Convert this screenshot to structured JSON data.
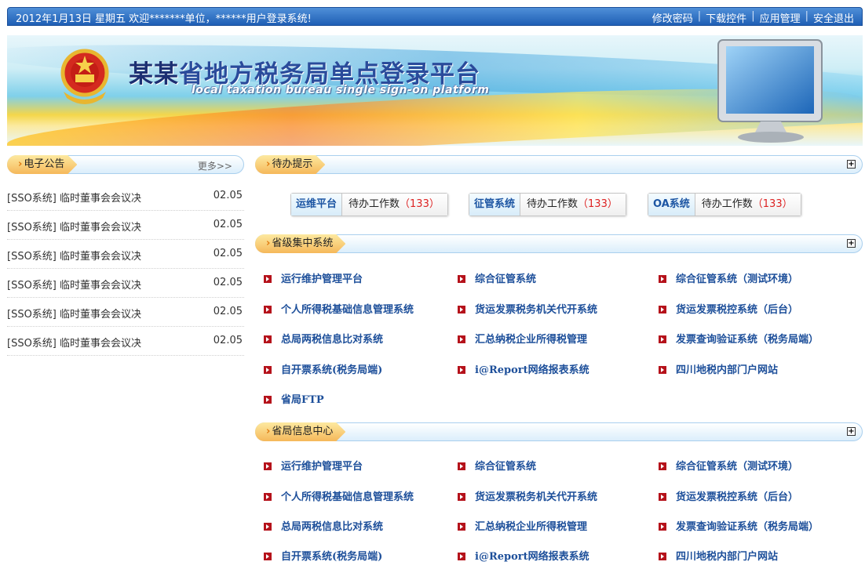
{
  "topbar": {
    "welcome": "2012年1月13日 星期五 欢迎*******单位，******用户登录系统!",
    "links": [
      "修改密码",
      "下载控件",
      "应用管理",
      "安全退出"
    ],
    "separator": "|"
  },
  "banner": {
    "title_dark": "某某",
    "title_rest": "省地方税务局单点登录平台",
    "subtitle": "local taxation bureau single sign-on platform"
  },
  "announcements": {
    "title": "电子公告",
    "more": "更多>>",
    "items": [
      {
        "text": "[SSO系统] 临时董事会会议决",
        "date": "02.05"
      },
      {
        "text": "[SSO系统] 临时董事会会议决",
        "date": "02.05"
      },
      {
        "text": "[SSO系统] 临时董事会会议决",
        "date": "02.05"
      },
      {
        "text": "[SSO系统] 临时董事会会议决",
        "date": "02.05"
      },
      {
        "text": "[SSO系统] 临时董事会会议决",
        "date": "02.05"
      },
      {
        "text": "[SSO系统] 临时董事会会议决",
        "date": "02.05"
      }
    ]
  },
  "todo": {
    "title": "待办提示",
    "expand": "+",
    "groups": [
      {
        "label": "运维平台",
        "count_label": "待办工作数",
        "count": "（133）"
      },
      {
        "label": "征管系统",
        "count_label": "待办工作数",
        "count": "（133）"
      },
      {
        "label": "OA系统",
        "count_label": "待办工作数",
        "count": "（133）"
      }
    ]
  },
  "provincial": {
    "title": "省级集中系统",
    "expand": "+",
    "items": [
      "运行维护管理平台",
      "综合征管系统",
      "综合征管系统（测试环境）",
      "个人所得税基础信息管理系统",
      "货运发票税务机关代开系统",
      "货运发票税控系统（后台）",
      "总局两税信息比对系统",
      "汇总纳税企业所得税管理",
      "发票查询验证系统（税务局端）",
      "自开票系统(税务局端)",
      "i@Report网络报表系统",
      "四川地税内部门户网站",
      "省局FTP"
    ]
  },
  "infocenter": {
    "title": "省局信息中心",
    "expand": "+",
    "items": [
      "运行维护管理平台",
      "综合征管系统",
      "综合征管系统（测试环境）",
      "个人所得税基础信息管理系统",
      "货运发票税务机关代开系统",
      "货运发票税控系统（后台）",
      "总局两税信息比对系统",
      "汇总纳税企业所得税管理",
      "发票查询验证系统（税务局端）",
      "自开票系统(税务局端)",
      "i@Report网络报表系统",
      "四川地税内部门户网站"
    ]
  }
}
